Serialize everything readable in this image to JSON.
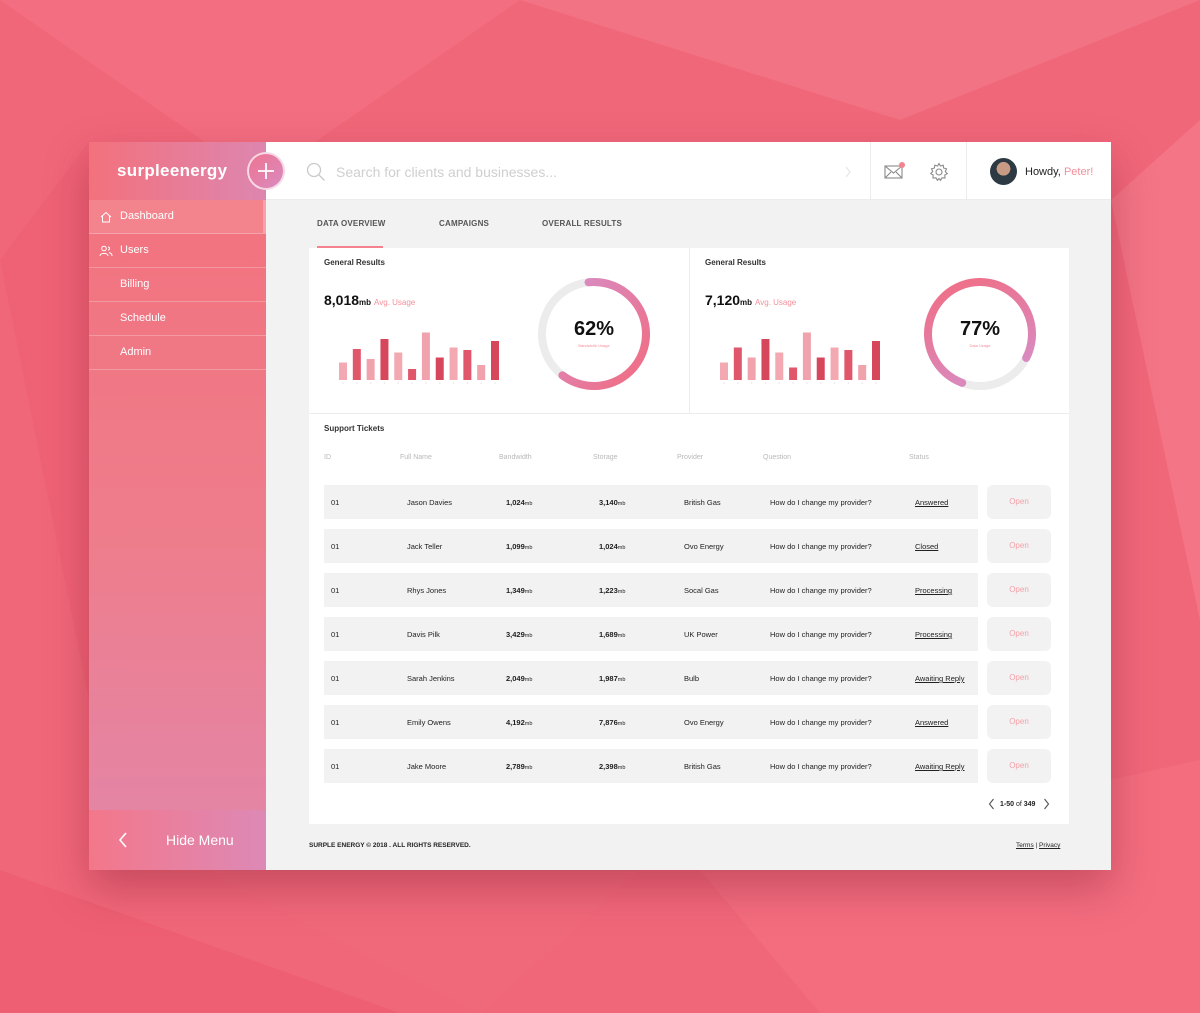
{
  "colors": {
    "background": "#f1677a",
    "accent": "#f48f9b",
    "gradient_start": "#f3717c",
    "gradient_end": "#d98bc0"
  },
  "brand": {
    "name": "surpleenergy"
  },
  "sidebar": {
    "items": [
      {
        "label": "Dashboard",
        "icon": "home-icon",
        "active": true
      },
      {
        "label": "Users",
        "icon": "users-icon",
        "active": false
      },
      {
        "label": "Billing",
        "icon": "",
        "active": false
      },
      {
        "label": "Schedule",
        "icon": "",
        "active": false
      },
      {
        "label": "Admin",
        "icon": "",
        "active": false
      }
    ],
    "hide_menu_label": "Hide Menu"
  },
  "topbar": {
    "search_placeholder": "Search for clients and businesses...",
    "greeting": "Howdy,",
    "user_name": "Peter!"
  },
  "tabs": [
    {
      "label": "DATA OVERVIEW",
      "active": true
    },
    {
      "label": "CAMPAIGNS",
      "active": false
    },
    {
      "label": "OVERALL RESULTS",
      "active": false
    }
  ],
  "results": [
    {
      "title": "General Results",
      "value": "8,018",
      "unit": "mb",
      "avg_label": "Avg. Usage",
      "percent_label": "62%",
      "percent": 0.62,
      "donut_caption": "Bandwidth Usage",
      "bars": [
        0.35,
        0.62,
        0.42,
        0.82,
        0.55,
        0.22,
        0.95,
        0.45,
        0.65,
        0.6,
        0.3,
        0.78
      ]
    },
    {
      "title": "General Results",
      "value": "7,120",
      "unit": "mb",
      "avg_label": "Avg. Usage",
      "percent_label": "77%",
      "percent": 0.77,
      "donut_caption": "Data Usage",
      "bars": [
        0.35,
        0.65,
        0.45,
        0.82,
        0.55,
        0.25,
        0.95,
        0.45,
        0.65,
        0.6,
        0.3,
        0.78
      ]
    }
  ],
  "tickets": {
    "title": "Support Tickets",
    "columns": [
      "ID",
      "Full Name",
      "Bandwidth",
      "Storage",
      "Provider",
      "Question",
      "Status"
    ],
    "open_label": "Open",
    "rows": [
      {
        "id": "01",
        "name": "Jason Davies",
        "bandwidth": "1,024",
        "storage": "3,140",
        "provider": "British Gas",
        "question": "How do I change my provider?",
        "status": "Answered"
      },
      {
        "id": "01",
        "name": "Jack Teller",
        "bandwidth": "1,099",
        "storage": "1,024",
        "provider": "Ovo Energy",
        "question": "How do I change my provider?",
        "status": "Closed"
      },
      {
        "id": "01",
        "name": "Rhys Jones",
        "bandwidth": "1,349",
        "storage": "1,223",
        "provider": "Socal Gas",
        "question": "How do I change my provider?",
        "status": "Processing"
      },
      {
        "id": "01",
        "name": "Davis Pilk",
        "bandwidth": "3,429",
        "storage": "1,689",
        "provider": "UK Power",
        "question": "How do I change my provider?",
        "status": "Processing"
      },
      {
        "id": "01",
        "name": "Sarah Jenkins",
        "bandwidth": "2,049",
        "storage": "1,987",
        "provider": "Bulb",
        "question": "How do I change my provider?",
        "status": "Awaiting Reply"
      },
      {
        "id": "01",
        "name": "Emily Owens",
        "bandwidth": "4,192",
        "storage": "7,876",
        "provider": "Ovo Energy",
        "question": "How do I change my provider?",
        "status": "Answered"
      },
      {
        "id": "01",
        "name": "Jake Moore",
        "bandwidth": "2,789",
        "storage": "2,398",
        "provider": "British Gas",
        "question": "How do I change my provider?",
        "status": "Awaiting Reply"
      }
    ],
    "unit": "mb",
    "pagination": {
      "range": "1-50",
      "of_label": "of",
      "total": "349"
    }
  },
  "footer": {
    "copyright": "SURPLE ENERGY © 2018 . ALL RIGHTS RESERVED.",
    "terms": "Terms",
    "separator": "|",
    "privacy": "Privacy"
  }
}
